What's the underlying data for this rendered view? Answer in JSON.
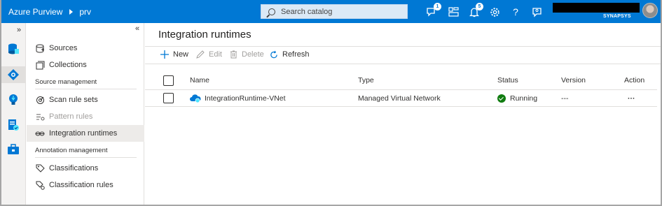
{
  "app": {
    "title": "Azure Purview",
    "breadcrumb": "prv"
  },
  "search": {
    "placeholder": "Search catalog"
  },
  "topbar": {
    "notifications_badge": "1",
    "alerts_badge": "5",
    "account_org": "SYNAPSYS",
    "icons": [
      "feedback-icon",
      "directory-icon",
      "notification-bell-icon",
      "settings-gear-icon",
      "help-icon",
      "person-feedback-icon"
    ]
  },
  "rail": {
    "collapse": "»",
    "icons": [
      "data-map-icon",
      "sources-nav-icon",
      "insights-icon",
      "policy-icon",
      "management-icon"
    ]
  },
  "sidebar": {
    "collapse": "«",
    "items": [
      {
        "label": "Sources",
        "icon": "sources-icon"
      },
      {
        "label": "Collections",
        "icon": "collections-icon"
      }
    ],
    "source_management": {
      "heading": "Source management",
      "items": [
        {
          "label": "Scan rule sets",
          "icon": "scan-rule-icon"
        },
        {
          "label": "Pattern rules",
          "icon": "pattern-rules-icon"
        },
        {
          "label": "Integration runtimes",
          "icon": "integration-runtime-icon"
        }
      ]
    },
    "annotation_management": {
      "heading": "Annotation management",
      "items": [
        {
          "label": "Classifications",
          "icon": "classification-icon"
        },
        {
          "label": "Classification rules",
          "icon": "classification-rules-icon"
        }
      ]
    }
  },
  "main": {
    "title": "Integration runtimes",
    "toolbar": {
      "new": "New",
      "edit": "Edit",
      "delete": "Delete",
      "refresh": "Refresh"
    },
    "columns": {
      "name": "Name",
      "type": "Type",
      "status": "Status",
      "version": "Version",
      "action": "Action"
    },
    "rows": [
      {
        "name": "IntegrationRuntime-VNet",
        "type": "Managed Virtual Network",
        "status": "Running",
        "version": "---",
        "action": "···"
      }
    ]
  },
  "colors": {
    "brand": "#0078d4",
    "status_running": "#107c10"
  }
}
